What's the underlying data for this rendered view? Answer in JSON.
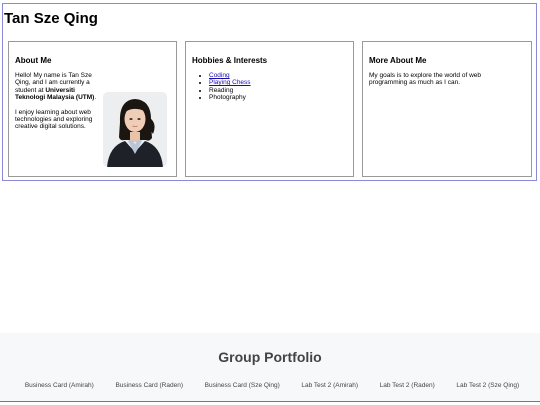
{
  "header": {
    "title": "Tan Sze Qing"
  },
  "about": {
    "heading": "About Me",
    "intro_plain": "Hello! My name is Tan Sze Qing, and I am currently a student at ",
    "university_bold": "Universiti Teknologi Malaysia (UTM)",
    "intro_end": ".",
    "paragraph2": "I enjoy learning about web technologies and exploring creative digital solutions."
  },
  "hobbies": {
    "heading": "Hobbies & Interests",
    "items": [
      {
        "label": "Coding",
        "link": true
      },
      {
        "label": "Playing Chess",
        "link": true
      },
      {
        "label": "Reading",
        "link": false
      },
      {
        "label": "Photography",
        "link": false
      }
    ]
  },
  "more": {
    "heading": "More About Me",
    "text": "My goals is to explore the world of web programming as much as I can."
  },
  "footer": {
    "title": "Group Portfolio",
    "links": [
      "Business Card (Amirah)",
      "Business Card (Raden)",
      "Business Card (Sze Qing)",
      "Lab Test 2 (Amirah)",
      "Lab Test 2 (Raden)",
      "Lab Test 2 (Sze Qing)"
    ]
  }
}
